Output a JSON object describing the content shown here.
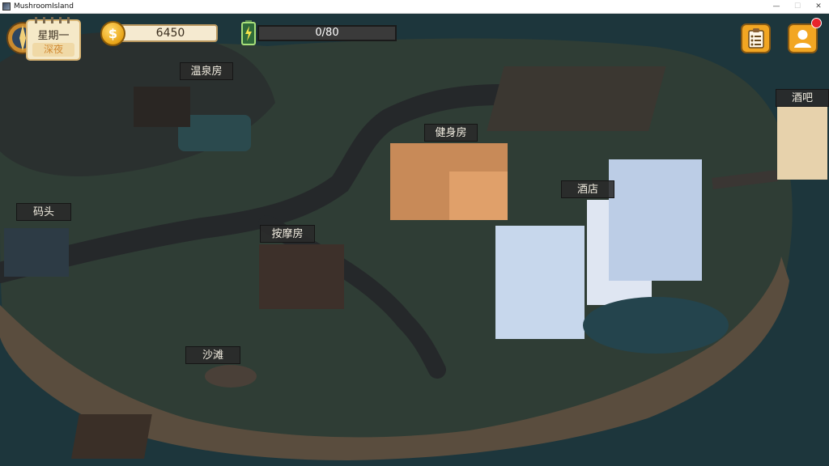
{
  "window": {
    "title": "MushroomIsland",
    "minimize": "—",
    "maximize": "☐",
    "close": "✕"
  },
  "hud": {
    "weekday": "星期一",
    "time_of_day": "深夜",
    "coins": "6450",
    "coin_symbol": "$",
    "energy_text": "0/80",
    "energy_fraction": 0,
    "tasks_icon": "clipboard-checklist-icon",
    "profile_icon": "user-profile-icon",
    "notification_color": "#e8232c"
  },
  "locations": {
    "hot_spring": "温泉房",
    "gym": "健身房",
    "bar": "酒吧",
    "hotel": "酒店",
    "dock": "码头",
    "massage": "按摩房",
    "beach": "沙滩"
  },
  "colors": {
    "ocean": "#1f3a40",
    "island": "#2e3b34",
    "sand": "#5f5141",
    "road": "#2b2e30",
    "hud_orange": "#f2a622",
    "energy_green": "#6ad14a"
  }
}
